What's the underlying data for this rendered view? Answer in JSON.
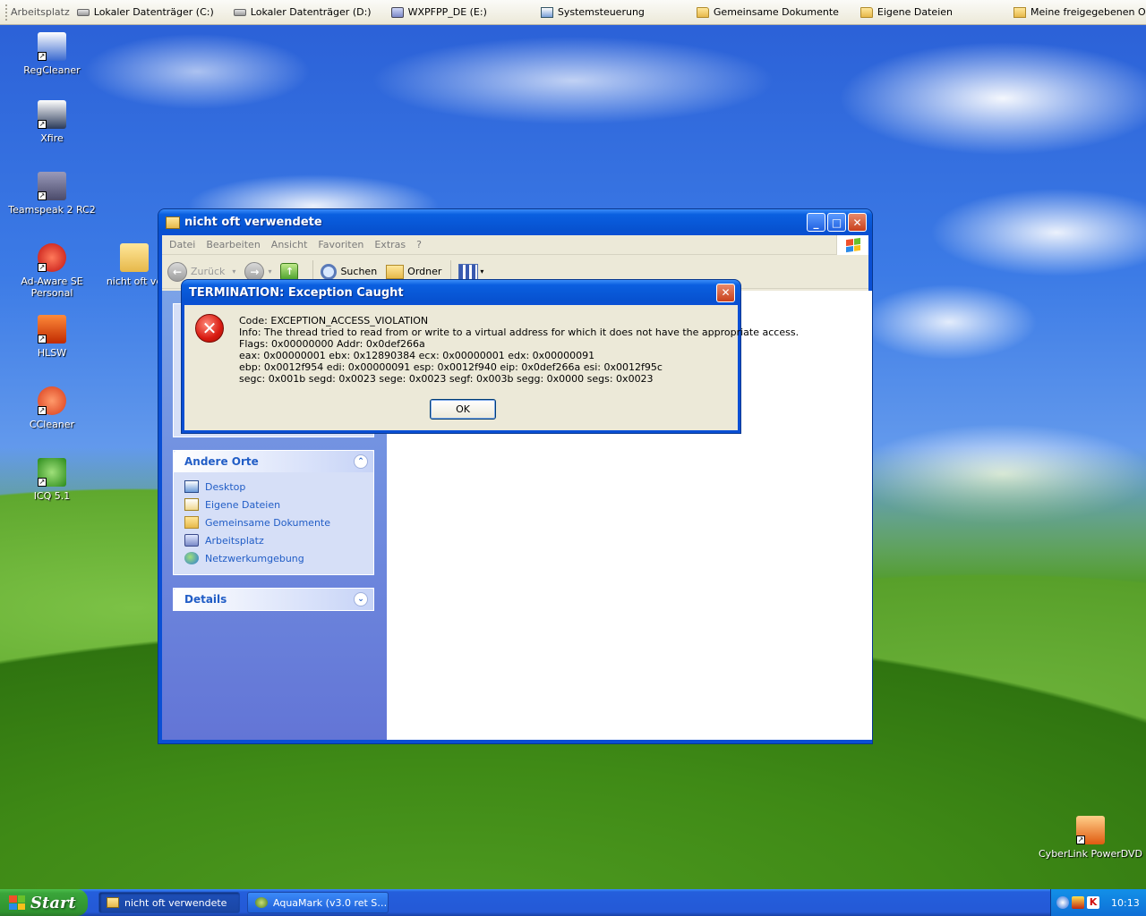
{
  "quicklaunch": {
    "items": [
      {
        "label": "Arbeitsplatz",
        "icon": "computer-icon"
      },
      {
        "label": "Lokaler Datenträger (C:)",
        "icon": "drive-icon"
      },
      {
        "label": "Lokaler Datenträger (D:)",
        "icon": "drive-icon"
      },
      {
        "label": "WXPFPP_DE (E:)",
        "icon": "cd-drive-icon"
      },
      {
        "label": "Systemsteuerung",
        "icon": "control-panel-icon"
      },
      {
        "label": "Gemeinsame Dokumente",
        "icon": "folder-icon"
      },
      {
        "label": "Eigene Dateien",
        "icon": "folder-icon"
      },
      {
        "label": "Meine freigegebenen Or…",
        "icon": "shared-folder-icon"
      }
    ]
  },
  "desktop": {
    "icons": [
      {
        "label": "RegCleaner",
        "icon": "regcleaner-icon",
        "color": "#3a6ad0"
      },
      {
        "label": "Xfire",
        "icon": "xfire-icon",
        "color": "#2a3a5a"
      },
      {
        "label": "Teamspeak 2 RC2",
        "icon": "teamspeak-icon",
        "color": "#6a6a8a"
      },
      {
        "label": "Ad-Aware SE Personal",
        "icon": "adaware-icon",
        "color": "#d02020"
      },
      {
        "label": "nicht oft ve",
        "icon": "folder-icon",
        "color": "#e6b84a"
      },
      {
        "label": "HLSW",
        "icon": "hlsw-icon",
        "color": "#e04010"
      },
      {
        "label": "CCleaner",
        "icon": "ccleaner-icon",
        "color": "#d83a1a"
      },
      {
        "label": "ICQ 5.1",
        "icon": "icq-icon",
        "color": "#3a9a2a"
      },
      {
        "label": "CyberLink PowerDVD",
        "icon": "powerdvd-icon",
        "color": "#e05a10"
      }
    ]
  },
  "explorer": {
    "title": "nicht oft verwendete",
    "menu": [
      "Datei",
      "Bearbeiten",
      "Ansicht",
      "Favoriten",
      "Extras",
      "?"
    ],
    "toolbar": {
      "back": "Zurück",
      "search": "Suchen",
      "folders": "Ordner"
    },
    "taskpane": {
      "other_places": {
        "title": "Andere Orte",
        "links": [
          {
            "label": "Desktop",
            "icon": "desktop-icon"
          },
          {
            "label": "Eigene Dateien",
            "icon": "my-documents-icon"
          },
          {
            "label": "Gemeinsame Dokumente",
            "icon": "folder-icon"
          },
          {
            "label": "Arbeitsplatz",
            "icon": "computer-icon"
          },
          {
            "label": "Netzwerkumgebung",
            "icon": "network-icon"
          }
        ]
      },
      "details": {
        "title": "Details"
      }
    }
  },
  "dialog": {
    "title": "TERMINATION: Exception Caught",
    "lines": [
      "Code: EXCEPTION_ACCESS_VIOLATION",
      "Info: The thread tried to read from or write to a virtual address for which it does not have the appropriate access.",
      "Flags: 0x00000000 Addr: 0x0def266a",
      "eax: 0x00000001 ebx: 0x12890384 ecx: 0x00000001 edx: 0x00000091",
      "ebp: 0x0012f954 edi: 0x00000091 esp: 0x0012f940 eip: 0x0def266a esi: 0x0012f95c",
      "segc: 0x001b segd: 0x0023 sege: 0x0023 segf: 0x003b segg: 0x0000 segs: 0x0023"
    ],
    "ok_label": "OK"
  },
  "taskbar": {
    "start_label": "Start",
    "tasks": [
      {
        "label": "nicht oft verwendete",
        "active": true
      },
      {
        "label": "AquaMark (v3.0 ret S…",
        "active": false
      }
    ],
    "clock": "10:13"
  },
  "colors": {
    "xp_blue": "#0a4fd4",
    "link_blue": "#215dc6",
    "start_green": "#3aa53a"
  }
}
